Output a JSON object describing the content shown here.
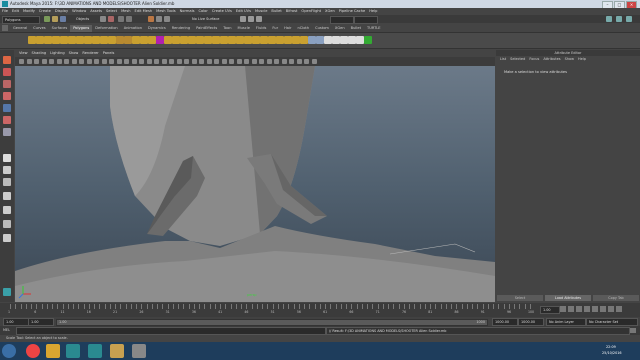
{
  "window": {
    "title": "Autodesk Maya 2015: F:\\3D ANIMATIONS AND MODELS\\SHOOTER Alien Soldier.mb"
  },
  "menubar": [
    "File",
    "Edit",
    "Modify",
    "Create",
    "Display",
    "Window",
    "Assets",
    "Select",
    "Mesh",
    "Edit Mesh",
    "Mesh Tools",
    "Normals",
    "Color",
    "Create UVs",
    "Edit UVs",
    "Muscle",
    "Bullet",
    "Bifrost",
    "OpenFlight",
    "XGen",
    "Pipeline Cache",
    "Help"
  ],
  "statusline": {
    "mode": "Polygons",
    "objects_label": "Objects",
    "no_live": "No Live Surface"
  },
  "shelf": {
    "tabs": [
      "General",
      "Curves",
      "Surfaces",
      "Polygons",
      "Deformation",
      "Animation",
      "Dynamics",
      "Rendering",
      "PaintEffects",
      "Toon",
      "Muscle",
      "Fluids",
      "Fur",
      "Hair",
      "nCloth",
      "Custom",
      "XGen",
      "Bullet",
      "TURTLE"
    ],
    "active": "Polygons"
  },
  "panel": {
    "menu": [
      "View",
      "Shading",
      "Lighting",
      "Show",
      "Renderer",
      "Panels"
    ],
    "axis_label": "persp"
  },
  "attribute_editor": {
    "title": "Attribute Editor",
    "menu": [
      "List",
      "Selected",
      "Focus",
      "Attributes",
      "Show",
      "Help"
    ],
    "message": "Make a selection to view attributes",
    "buttons": [
      "Select",
      "Load Attributes",
      "Copy Tab"
    ]
  },
  "timeslider": {
    "ticks": [
      1,
      2,
      3,
      4,
      5,
      6,
      7,
      8,
      9,
      10,
      11,
      12,
      13,
      14,
      15,
      16,
      17,
      18,
      19,
      20,
      21,
      22,
      23,
      24,
      25,
      26,
      27,
      28,
      29,
      30,
      31,
      32,
      33,
      34,
      35,
      36,
      37,
      38,
      39,
      40,
      41,
      42,
      43,
      44,
      45,
      46,
      47,
      48,
      49,
      50,
      51,
      52,
      53,
      54,
      55,
      56,
      57,
      58,
      59,
      60,
      61,
      62,
      63,
      64,
      65,
      66,
      67,
      68,
      69,
      70,
      71,
      72,
      73,
      74,
      75,
      76,
      77,
      78,
      79,
      80,
      81,
      82,
      83,
      84,
      85,
      86,
      87,
      88,
      89,
      90,
      91,
      92,
      93,
      94,
      95,
      96,
      97,
      98,
      99,
      100
    ],
    "current": "1.00"
  },
  "range": {
    "start": "1.00",
    "inner_start": "1.00",
    "inner_end": "1000",
    "end": "1000.00",
    "end2": "1000.00",
    "anim_layer": "No Anim Layer",
    "char_set": "No Character Set"
  },
  "cmdline": {
    "label": "MEL",
    "result": "// Result: F:/3D ANIMATIONS AND MODELS/SHOOTER Alien Soldier.mb"
  },
  "helpline": {
    "text": "Scale Tool: Select an object to scale."
  },
  "taskbar": {
    "time": "22:09",
    "date": "25/10/2016"
  },
  "colors": {
    "viewport_top": "#6f7d8c",
    "viewport_bottom": "#3b4754",
    "taskbar": "#1e3d5c",
    "accent": "#4cc3d9"
  }
}
